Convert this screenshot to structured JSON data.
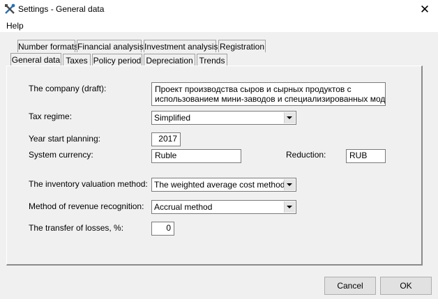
{
  "window": {
    "title": "Settings - General data",
    "close_glyph": "✕"
  },
  "menu": {
    "help": "Help"
  },
  "tabs_row1": [
    "Number formats",
    "Financial analysis",
    "Investment analysis",
    "Registration"
  ],
  "tabs_row2": [
    "General data",
    "Taxes",
    "Policy period",
    "Depreciation",
    "Trends"
  ],
  "form": {
    "company_label": "The company (draft):",
    "company_value_line1": "Проект производства сыров и сырных продуктов с",
    "company_value_line2": "использованием мини-заводов и специализированных модулей",
    "tax_regime_label": "Tax regime:",
    "tax_regime_value": "Simplified",
    "year_label": "Year start planning:",
    "year_value": "2017",
    "currency_label": "System currency:",
    "currency_value": "Ruble",
    "reduction_label": "Reduction:",
    "reduction_value": "RUB",
    "inventory_label": "The inventory valuation method:",
    "inventory_value": "The weighted average cost method",
    "revenue_label": "Method of revenue recognition:",
    "revenue_value": "Accrual method",
    "losses_label": "The transfer of losses, %:",
    "losses_value": "0"
  },
  "buttons": {
    "cancel": "Cancel",
    "ok": "OK"
  },
  "icons": {
    "app": "tools-icon",
    "close": "close-icon",
    "dropdown": "chevron-down-icon"
  }
}
